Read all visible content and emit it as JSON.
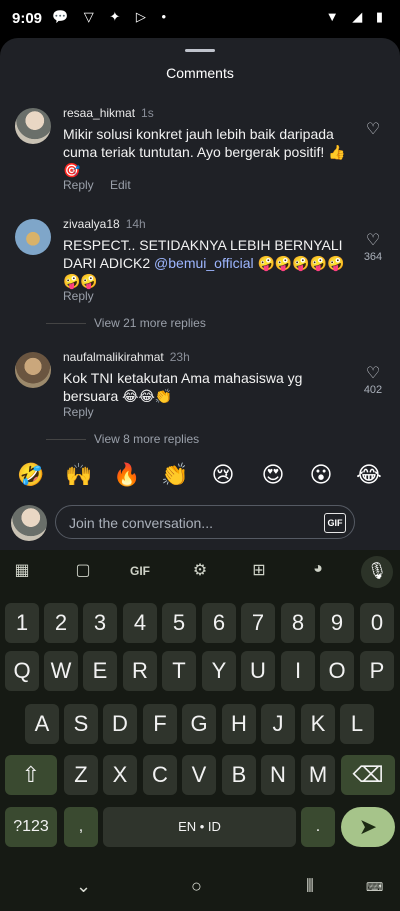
{
  "status": {
    "time": "9:09"
  },
  "sheet": {
    "title": "Comments"
  },
  "comments": [
    {
      "user": "resaa_hikmat",
      "time": "1s",
      "text": "Mikir solusi konkret jauh lebih baik daripada cuma teriak tuntutan. Ayo bergerak positif! 👍🎯",
      "reply": "Reply",
      "edit": "Edit"
    },
    {
      "user": "zivaalya18",
      "time": "14h",
      "text_a": "RESPECT.. SETIDAKNYA LEBIH BERNYALI DARI ADICK2 ",
      "mention": "@bemui_official",
      "text_b": " 🤪🤪🤪🤪🤪🤪🤪",
      "likes": "364",
      "reply": "Reply",
      "more": "View 21 more replies"
    },
    {
      "user": "naufalmalikirahmat",
      "time": "23h",
      "text": "Kok TNI ketakutan Ama mahasiswa yg bersuara 😂😂👏",
      "likes": "402",
      "reply": "Reply",
      "more": "View 8 more replies"
    }
  ],
  "emojis": [
    "🤣",
    "🙌",
    "🔥",
    "👏",
    "😢",
    "😍",
    "😮",
    "😂"
  ],
  "input": {
    "placeholder": "Join the conversation...",
    "gif": "GIF"
  },
  "keyboard": {
    "toolbar_gif": "GIF",
    "row_numbers": [
      "1",
      "2",
      "3",
      "4",
      "5",
      "6",
      "7",
      "8",
      "9",
      "0"
    ],
    "row1": [
      "Q",
      "W",
      "E",
      "R",
      "T",
      "Y",
      "U",
      "I",
      "O",
      "P"
    ],
    "row2": [
      "A",
      "S",
      "D",
      "F",
      "G",
      "H",
      "J",
      "K",
      "L"
    ],
    "row3": [
      "Z",
      "X",
      "C",
      "V",
      "B",
      "N",
      "M"
    ],
    "symbols": "?123",
    "comma": ",",
    "space": "EN • ID",
    "period": "."
  }
}
